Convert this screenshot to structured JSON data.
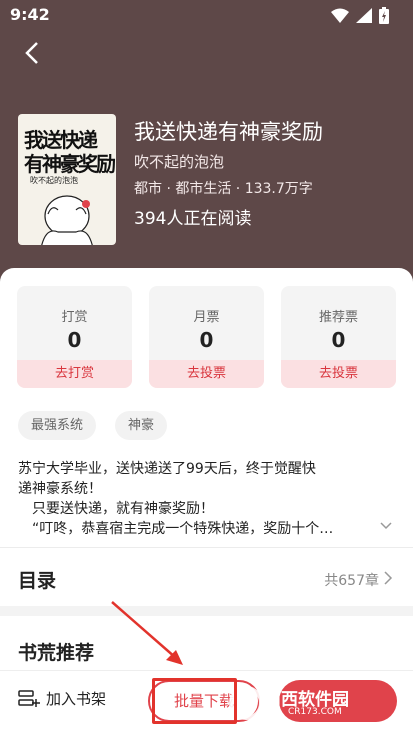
{
  "status_bar": {
    "time": "9:42"
  },
  "book": {
    "cover_line1": "我送快递",
    "cover_line2": "有神豪奖励",
    "cover_line3": "吹不起的泡泡",
    "title": "我送快递有神豪奖励",
    "author": "吹不起的泡泡",
    "meta": "都市 · 都市生活 · 133.7万字",
    "readers": "394人正在阅读"
  },
  "stats": [
    {
      "label": "打赏",
      "value": "0",
      "action": "去打赏"
    },
    {
      "label": "月票",
      "value": "0",
      "action": "去投票"
    },
    {
      "label": "推荐票",
      "value": "0",
      "action": "去投票"
    }
  ],
  "tags": [
    "最强系统",
    "神豪"
  ],
  "description": {
    "line1": "苏宁大学毕业，送快递送了99天后，终于觉醒快",
    "line2": "递神豪系统！",
    "line3": "　只要送快递，就有神豪奖励！",
    "line4": "　“叮咚，恭喜宿主完成一个特殊快递，奖励十个…"
  },
  "toc": {
    "title": "目录",
    "count": "共657章"
  },
  "recommend": {
    "title": "书荒推荐"
  },
  "bottom": {
    "add_shelf": "加入书架",
    "download": "批量下载"
  },
  "watermark": {
    "main": "西西软件园",
    "sub": "CR173.COM"
  },
  "colors": {
    "header_bg": "#5e4848",
    "accent": "#e0434b",
    "annotation": "#e2332c"
  }
}
